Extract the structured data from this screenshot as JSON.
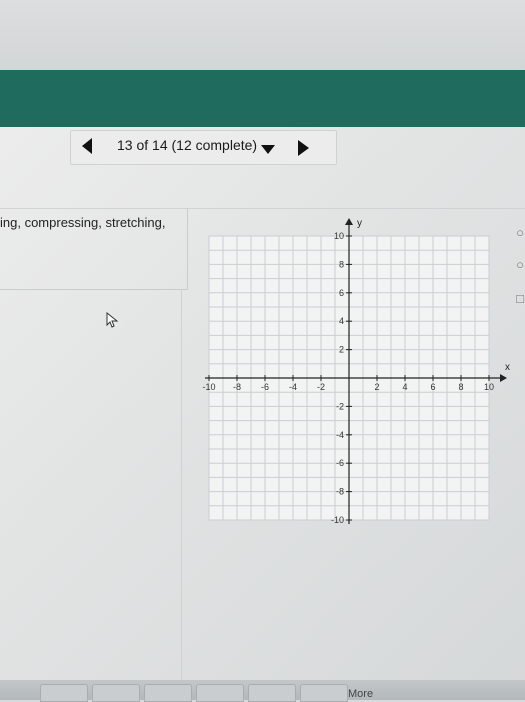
{
  "nav": {
    "progress_label": "13 of 14 (12 complete)",
    "prev_icon": "triangle-left-icon",
    "next_icon": "triangle-right-icon",
    "dropdown_icon": "triangle-down-icon"
  },
  "instruction": {
    "text": "ing, compressing, stretching,"
  },
  "graph": {
    "x_axis_label": "x",
    "y_axis_label": "y",
    "x_range": [
      -10,
      10
    ],
    "y_range": [
      -10,
      10
    ],
    "grid_step": 1,
    "x_tick_labels": [
      "-10",
      "-8",
      "-6",
      "-4",
      "-2",
      "2",
      "4",
      "6",
      "8",
      "10"
    ],
    "y_tick_labels": [
      "10",
      "8",
      "6",
      "4",
      "2",
      "-2",
      "-4",
      "-6",
      "-8",
      "-10"
    ]
  },
  "side_controls": {
    "icons": [
      "circle-tool-icon",
      "circle-tool-icon",
      "clear-icon"
    ]
  },
  "bottom": {
    "more_label": "More"
  },
  "colors": {
    "header": "#1f6b5d",
    "grid": "#c9cfd2",
    "axis": "#222222"
  }
}
